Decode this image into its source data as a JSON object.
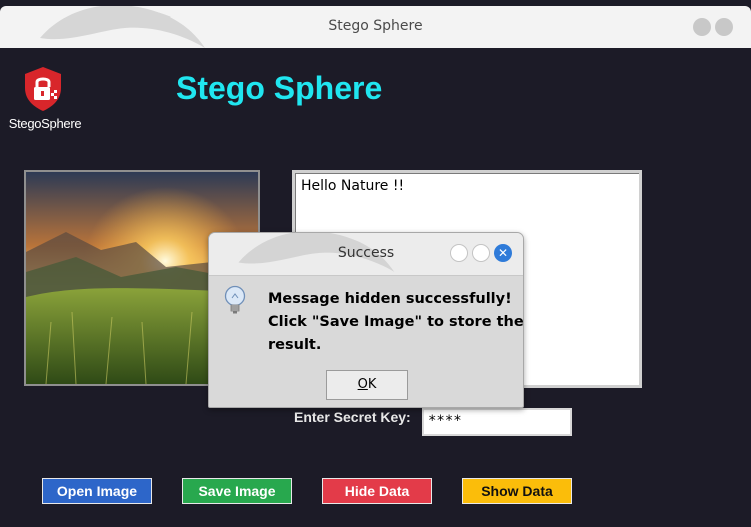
{
  "window": {
    "title": "Stego Sphere"
  },
  "logo": {
    "text": "StegoSphere",
    "icon": "lock-shield-icon",
    "color": "#d8262b"
  },
  "app": {
    "title": "Stego Sphere",
    "title_color": "#20e6f0"
  },
  "image_preview": {
    "description_icon": "mountain-sunset-image"
  },
  "message_box": {
    "value": "Hello Nature !!"
  },
  "secret_key": {
    "label": "Enter Secret Key:",
    "value": "****"
  },
  "buttons": {
    "open": "Open Image",
    "save": "Save Image",
    "hide": "Hide Data",
    "show": "Show Data"
  },
  "dialog": {
    "title": "Success",
    "icon": "lightbulb-icon",
    "message_lines": [
      "Message hidden successfully!",
      "Click \"Save Image\" to store the",
      "result."
    ],
    "ok_underlined": "O",
    "ok_rest": "K"
  },
  "colors": {
    "background": "#1c1b27",
    "open_button": "#2d66c9",
    "save_button": "#28a84e",
    "hide_button": "#e33b49",
    "show_button": "#fbbd0a",
    "dialog_close": "#2f7bd9"
  }
}
